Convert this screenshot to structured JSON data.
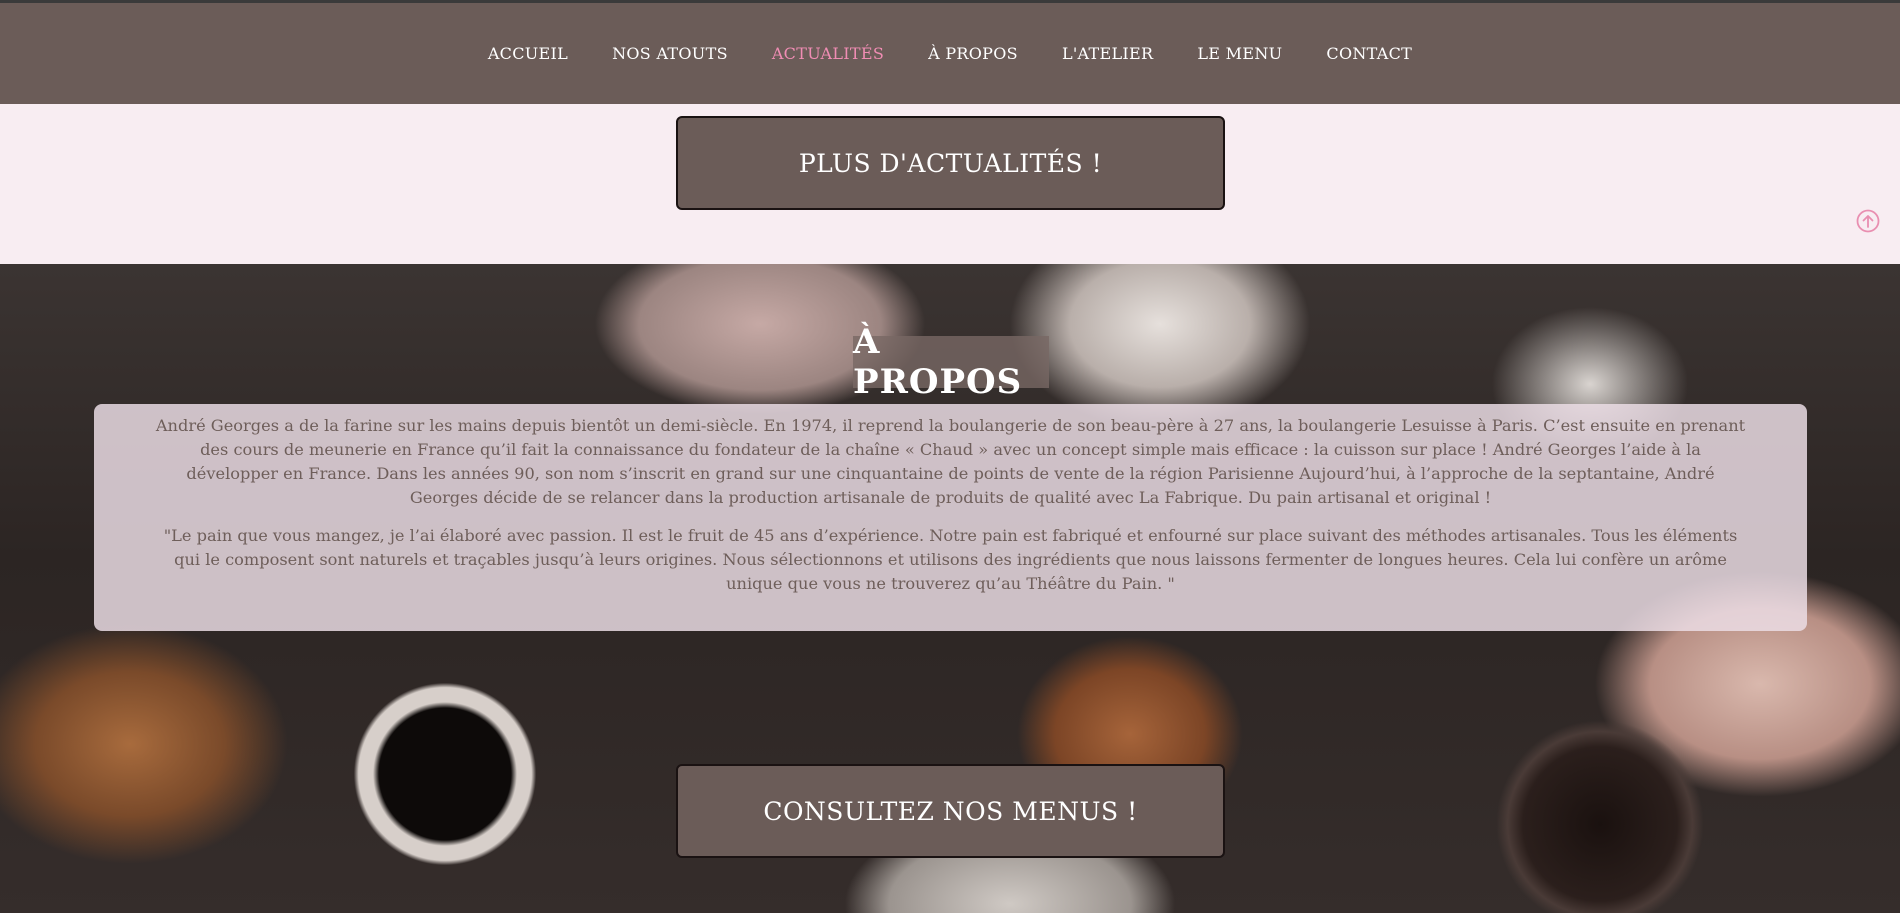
{
  "nav": {
    "items": [
      {
        "label": "ACCUEIL"
      },
      {
        "label": "NOS ATOUTS"
      },
      {
        "label": "ACTUALITÉS"
      },
      {
        "label": "À PROPOS"
      },
      {
        "label": "L'ATELIER"
      },
      {
        "label": "LE MENU"
      },
      {
        "label": "CONTACT"
      }
    ],
    "active_index": 2,
    "active_color": "#f08db4",
    "bar_color": "#6b5c58"
  },
  "news": {
    "button_label": "PLUS D'ACTUALITÉS !"
  },
  "back_to_top": {
    "icon": "arrow-up-circle-icon",
    "color": "#e98fb1"
  },
  "about": {
    "title": "À PROPOS",
    "paragraph_1": "André Georges a de la farine sur les mains depuis bientôt un demi-siècle. En 1974, il reprend la boulangerie de son beau-père à 27 ans, la boulangerie Lesuisse à Paris. C’est ensuite en prenant des cours de meunerie en France qu’il fait la connaissance du fondateur de la chaîne « Chaud » avec un concept simple mais efficace : la cuisson sur place  ! André Georges l’aide à la développer en France. Dans les années 90, son nom s’inscrit en grand sur une cinquantaine de points de vente de la région Parisienne Aujourd’hui, à l’approche de la septantaine, André Georges décide de se relancer dans la production artisanale de produits de qualité avec La Fabrique. Du pain artisanal et original !",
    "paragraph_2": "\"Le pain que vous mangez, je l’ai élaboré avec passion. Il est le fruit de 45 ans d’expérience. Notre pain est fabriqué et enfourné sur place suivant des méthodes artisanales. Tous les éléments qui le composent sont naturels et traçables jusqu’à leurs origines. Nous sélectionnons et utilisons des ingrédients que nous laissons fermenter de longues heures. Cela lui confère un arôme unique que vous ne trouverez qu’au Théâtre du Pain. \""
  },
  "menus": {
    "button_label": "CONSULTEZ NOS MENUS !"
  }
}
